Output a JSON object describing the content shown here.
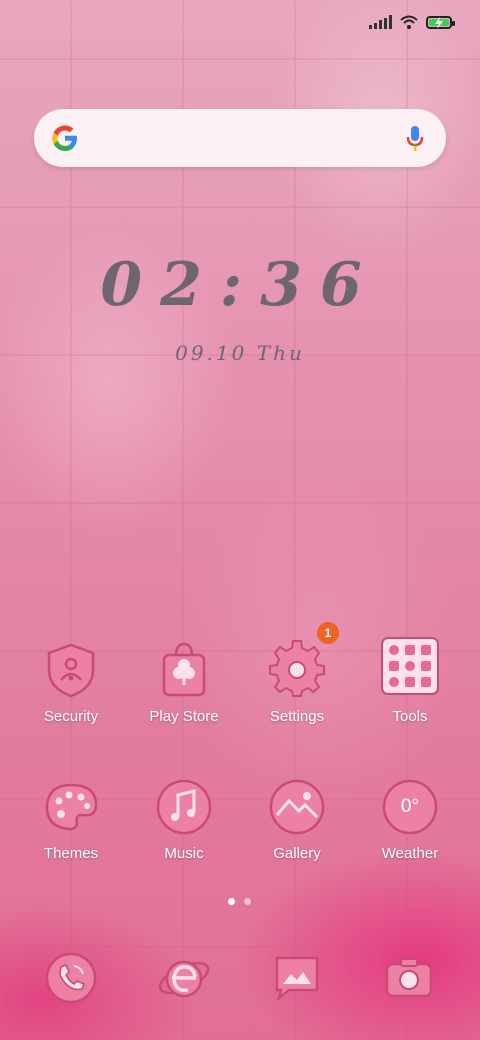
{
  "status": {
    "signal_bars": 5,
    "wifi": "wifi-icon",
    "battery": "battery-charging-icon",
    "battery_color": "#3ecf4a"
  },
  "search": {
    "placeholder": ""
  },
  "clock": {
    "time": "02:36",
    "date": "09.10 Thu"
  },
  "apps": [
    {
      "label": "Security",
      "icon": "shield-icon"
    },
    {
      "label": "Play Store",
      "icon": "shopping-bag-icon"
    },
    {
      "label": "Settings",
      "icon": "gear-icon",
      "badge": "1"
    },
    {
      "label": "Tools",
      "icon": "tools-grid-icon"
    },
    {
      "label": "Themes",
      "icon": "palette-icon"
    },
    {
      "label": "Music",
      "icon": "music-note-icon"
    },
    {
      "label": "Gallery",
      "icon": "gallery-icon"
    },
    {
      "label": "Weather",
      "icon": "weather-icon",
      "value": "0°"
    }
  ],
  "pages": {
    "total": 2,
    "current": 1
  },
  "dock": [
    {
      "icon": "phone-icon"
    },
    {
      "icon": "browser-icon"
    },
    {
      "icon": "messages-icon"
    },
    {
      "icon": "camera-icon"
    }
  ],
  "colors": {
    "icon_fill": "#ec81a4",
    "icon_stroke": "#c94a76",
    "badge": "#f06122"
  }
}
